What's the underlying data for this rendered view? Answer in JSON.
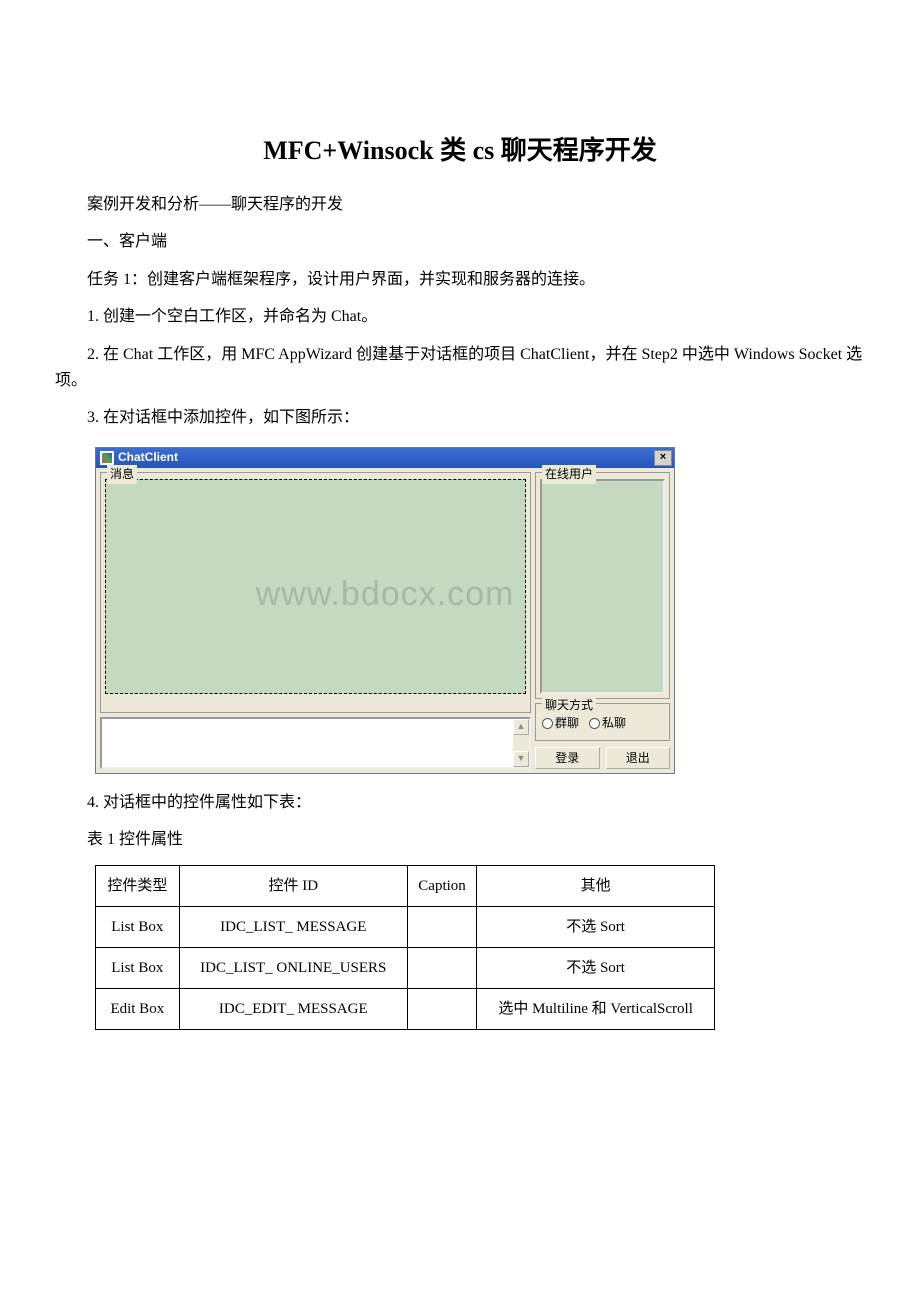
{
  "title": "MFC+Winsock 类 cs 聊天程序开发",
  "para1": "案例开发和分析——聊天程序的开发",
  "para2": "一、客户端",
  "para3": "任务 1：创建客户端框架程序，设计用户界面，并实现和服务器的连接。",
  "para4": "1. 创建一个空白工作区，并命名为 Chat。",
  "para5": "2. 在 Chat 工作区，用 MFC AppWizard 创建基于对话框的项目 ChatClient，并在 Step2 中选中 Windows Socket 选项。",
  "para6": "3. 在对话框中添加控件，如下图所示：",
  "para7": "4. 对话框中的控件属性如下表：",
  "para8": "表 1 控件属性",
  "dialog": {
    "title": "ChatClient",
    "close": "×",
    "group_msg": "消息",
    "group_users": "在线用户",
    "group_mode": "聊天方式",
    "radio_group": "群聊",
    "radio_private": "私聊",
    "btn_login": "登录",
    "btn_exit": "退出",
    "scroll_up": "▲",
    "scroll_down": "▼"
  },
  "watermark": "www.bdocx.com",
  "table": {
    "headers": {
      "c1": "控件类型",
      "c2": "控件 ID",
      "c3": "Caption",
      "c4": "其他"
    },
    "rows": [
      {
        "c1": "List Box",
        "c2": "IDC_LIST_ MESSAGE",
        "c3": "",
        "c4": "不选 Sort"
      },
      {
        "c1": "List Box",
        "c2": "IDC_LIST_ ONLINE_USERS",
        "c3": "",
        "c4": "不选 Sort"
      },
      {
        "c1": "Edit Box",
        "c2": "IDC_EDIT_ MESSAGE",
        "c3": "",
        "c4": "选中 Multiline 和 VerticalScroll"
      }
    ]
  }
}
